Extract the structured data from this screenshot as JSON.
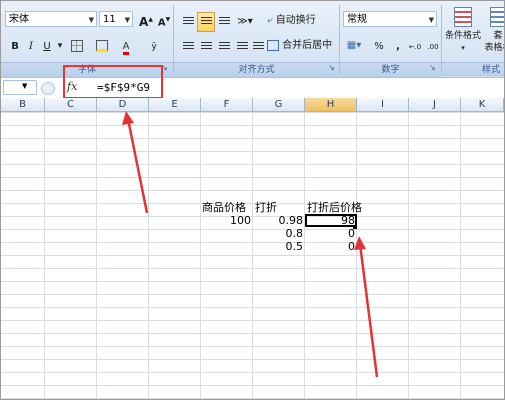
{
  "ribbon": {
    "font_name": "宋体",
    "font_size": "11",
    "grow_font": "A",
    "shrink_font": "A",
    "bold": "B",
    "italic": "I",
    "underline": "U",
    "font_color_glyph": "A",
    "wrap_text": "自动换行",
    "merge_center": "合并后居中",
    "number_format": "常规",
    "percent": "%",
    "comma": ",",
    "inc_decimal": "←.0",
    "dec_decimal": ".00",
    "conditional_format_line1": "条件格式",
    "table_format_line1": "套",
    "table_format_line2": "表格格",
    "group_font": "字体",
    "group_alignment": "对齐方式",
    "group_number": "数字",
    "group_styles": "样式"
  },
  "formula_bar": {
    "fx": "fx",
    "formula": "=$F$9*G9"
  },
  "columns": [
    "B",
    "C",
    "D",
    "E",
    "F",
    "G",
    "H",
    "I",
    "J",
    "K"
  ],
  "cells": {
    "header_price": "商品价格",
    "header_discount": "打折",
    "header_after": "打折后价格",
    "price": "100",
    "d1": "0.98",
    "d2": "0.8",
    "d3": "0.5",
    "r1": "98",
    "r2": "0",
    "r3": "0"
  },
  "colors": {
    "annotation_red": "#e33333"
  }
}
